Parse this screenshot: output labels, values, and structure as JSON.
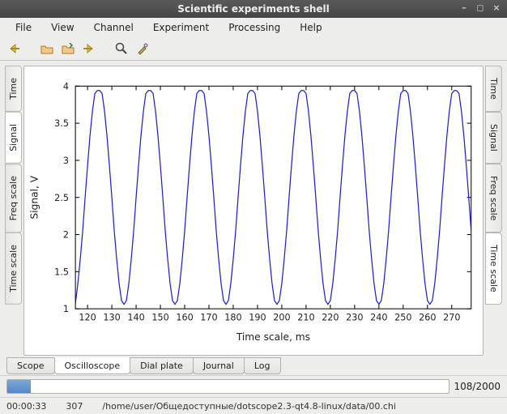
{
  "window": {
    "title": "Scientific experiments shell"
  },
  "menu": {
    "file": "File",
    "view": "View",
    "channel": "Channel",
    "experiment": "Experiment",
    "processing": "Processing",
    "help": "Help"
  },
  "left_tabs": {
    "t0": "Time",
    "t1": "Signal",
    "t2": "Freq scale",
    "t3": "Time scale"
  },
  "right_tabs": {
    "t0": "Time",
    "t1": "Signal",
    "t2": "Freq scale",
    "t3": "Time scale"
  },
  "bottom_tabs": {
    "t0": "Scope",
    "t1": "Oscilloscope",
    "t2": "Dial plate",
    "t3": "Journal",
    "t4": "Log"
  },
  "progress": {
    "label": "108/2000",
    "percent": 5.4
  },
  "status": {
    "time": "00:00:33",
    "count": "307",
    "path": "/home/user/Общедоступные/dotscope2.3-qt4.8-linux/data/00.chi"
  },
  "chart_data": {
    "type": "line",
    "title": "",
    "xlabel": "Time scale, ms",
    "ylabel": "Signal, V",
    "xlim": [
      115,
      278
    ],
    "ylim": [
      1,
      4
    ],
    "xticks": [
      120,
      130,
      140,
      150,
      160,
      170,
      180,
      190,
      200,
      210,
      220,
      230,
      240,
      250,
      260,
      270
    ],
    "yticks": [
      1,
      1.5,
      2,
      2.5,
      3,
      3.5,
      4
    ],
    "series": [
      {
        "name": "signal",
        "color": "#1e1ec8",
        "amplitude": 1.45,
        "offset": 2.5,
        "period_ms": 20,
        "phase_ms": 120,
        "x": [
          115,
          116,
          117,
          118,
          119,
          120,
          121,
          122,
          123,
          124,
          125,
          126,
          127,
          128,
          129,
          130,
          131,
          132,
          133,
          134,
          135,
          136,
          137,
          138,
          139,
          140,
          141,
          142,
          143,
          144,
          145,
          146,
          147,
          148,
          149,
          150,
          151,
          152,
          153,
          154,
          155,
          156,
          157,
          158,
          159,
          160,
          161,
          162,
          163,
          164,
          165,
          166,
          167,
          168,
          169,
          170,
          171,
          172,
          173,
          174,
          175,
          176,
          177,
          178,
          179,
          180,
          181,
          182,
          183,
          184,
          185,
          186,
          187,
          188,
          189,
          190,
          191,
          192,
          193,
          194,
          195,
          196,
          197,
          198,
          199,
          200,
          201,
          202,
          203,
          204,
          205,
          206,
          207,
          208,
          209,
          210,
          211,
          212,
          213,
          214,
          215,
          216,
          217,
          218,
          219,
          220,
          221,
          222,
          223,
          224,
          225,
          226,
          227,
          228,
          229,
          230,
          231,
          232,
          233,
          234,
          235,
          236,
          237,
          238,
          239,
          240,
          241,
          242,
          243,
          244,
          245,
          246,
          247,
          248,
          249,
          250,
          251,
          252,
          253,
          254,
          255,
          256,
          257,
          258,
          259,
          260,
          261,
          262,
          263,
          264,
          265,
          266,
          267,
          268,
          269,
          270,
          271,
          272,
          273,
          274,
          275,
          276,
          277,
          278
        ],
        "y": [
          1.07,
          1.34,
          1.67,
          2.05,
          2.5,
          2.93,
          3.33,
          3.66,
          3.9,
          3.94,
          3.94,
          3.9,
          3.66,
          3.33,
          2.93,
          2.5,
          2.05,
          1.67,
          1.34,
          1.11,
          1.06,
          1.11,
          1.34,
          1.67,
          2.05,
          2.5,
          2.93,
          3.33,
          3.66,
          3.9,
          3.94,
          3.94,
          3.9,
          3.66,
          3.33,
          2.93,
          2.5,
          2.05,
          1.67,
          1.34,
          1.11,
          1.06,
          1.11,
          1.34,
          1.67,
          2.05,
          2.5,
          2.93,
          3.33,
          3.66,
          3.9,
          3.94,
          3.94,
          3.9,
          3.66,
          3.33,
          2.93,
          2.5,
          2.05,
          1.67,
          1.34,
          1.11,
          1.06,
          1.11,
          1.34,
          1.67,
          2.05,
          2.5,
          2.93,
          3.33,
          3.66,
          3.9,
          3.94,
          3.94,
          3.9,
          3.66,
          3.33,
          2.93,
          2.5,
          2.05,
          1.67,
          1.34,
          1.11,
          1.06,
          1.11,
          1.34,
          1.67,
          2.05,
          2.5,
          2.93,
          3.33,
          3.66,
          3.9,
          3.94,
          3.94,
          3.9,
          3.66,
          3.33,
          2.93,
          2.5,
          2.05,
          1.67,
          1.34,
          1.11,
          1.06,
          1.11,
          1.34,
          1.67,
          2.05,
          2.5,
          2.93,
          3.33,
          3.66,
          3.9,
          3.94,
          3.94,
          3.9,
          3.66,
          3.33,
          2.93,
          2.5,
          2.05,
          1.67,
          1.34,
          1.11,
          1.06,
          1.11,
          1.34,
          1.67,
          2.05,
          2.5,
          2.93,
          3.33,
          3.66,
          3.9,
          3.94,
          3.94,
          3.9,
          3.66,
          3.33,
          2.93,
          2.5,
          2.05,
          1.67,
          1.34,
          1.11,
          1.06,
          1.11,
          1.34,
          1.67,
          2.05,
          2.5,
          2.93,
          3.33,
          3.66,
          3.9,
          3.94,
          3.94,
          3.9,
          3.66,
          3.33,
          2.93,
          2.5,
          2.05
        ]
      }
    ]
  }
}
